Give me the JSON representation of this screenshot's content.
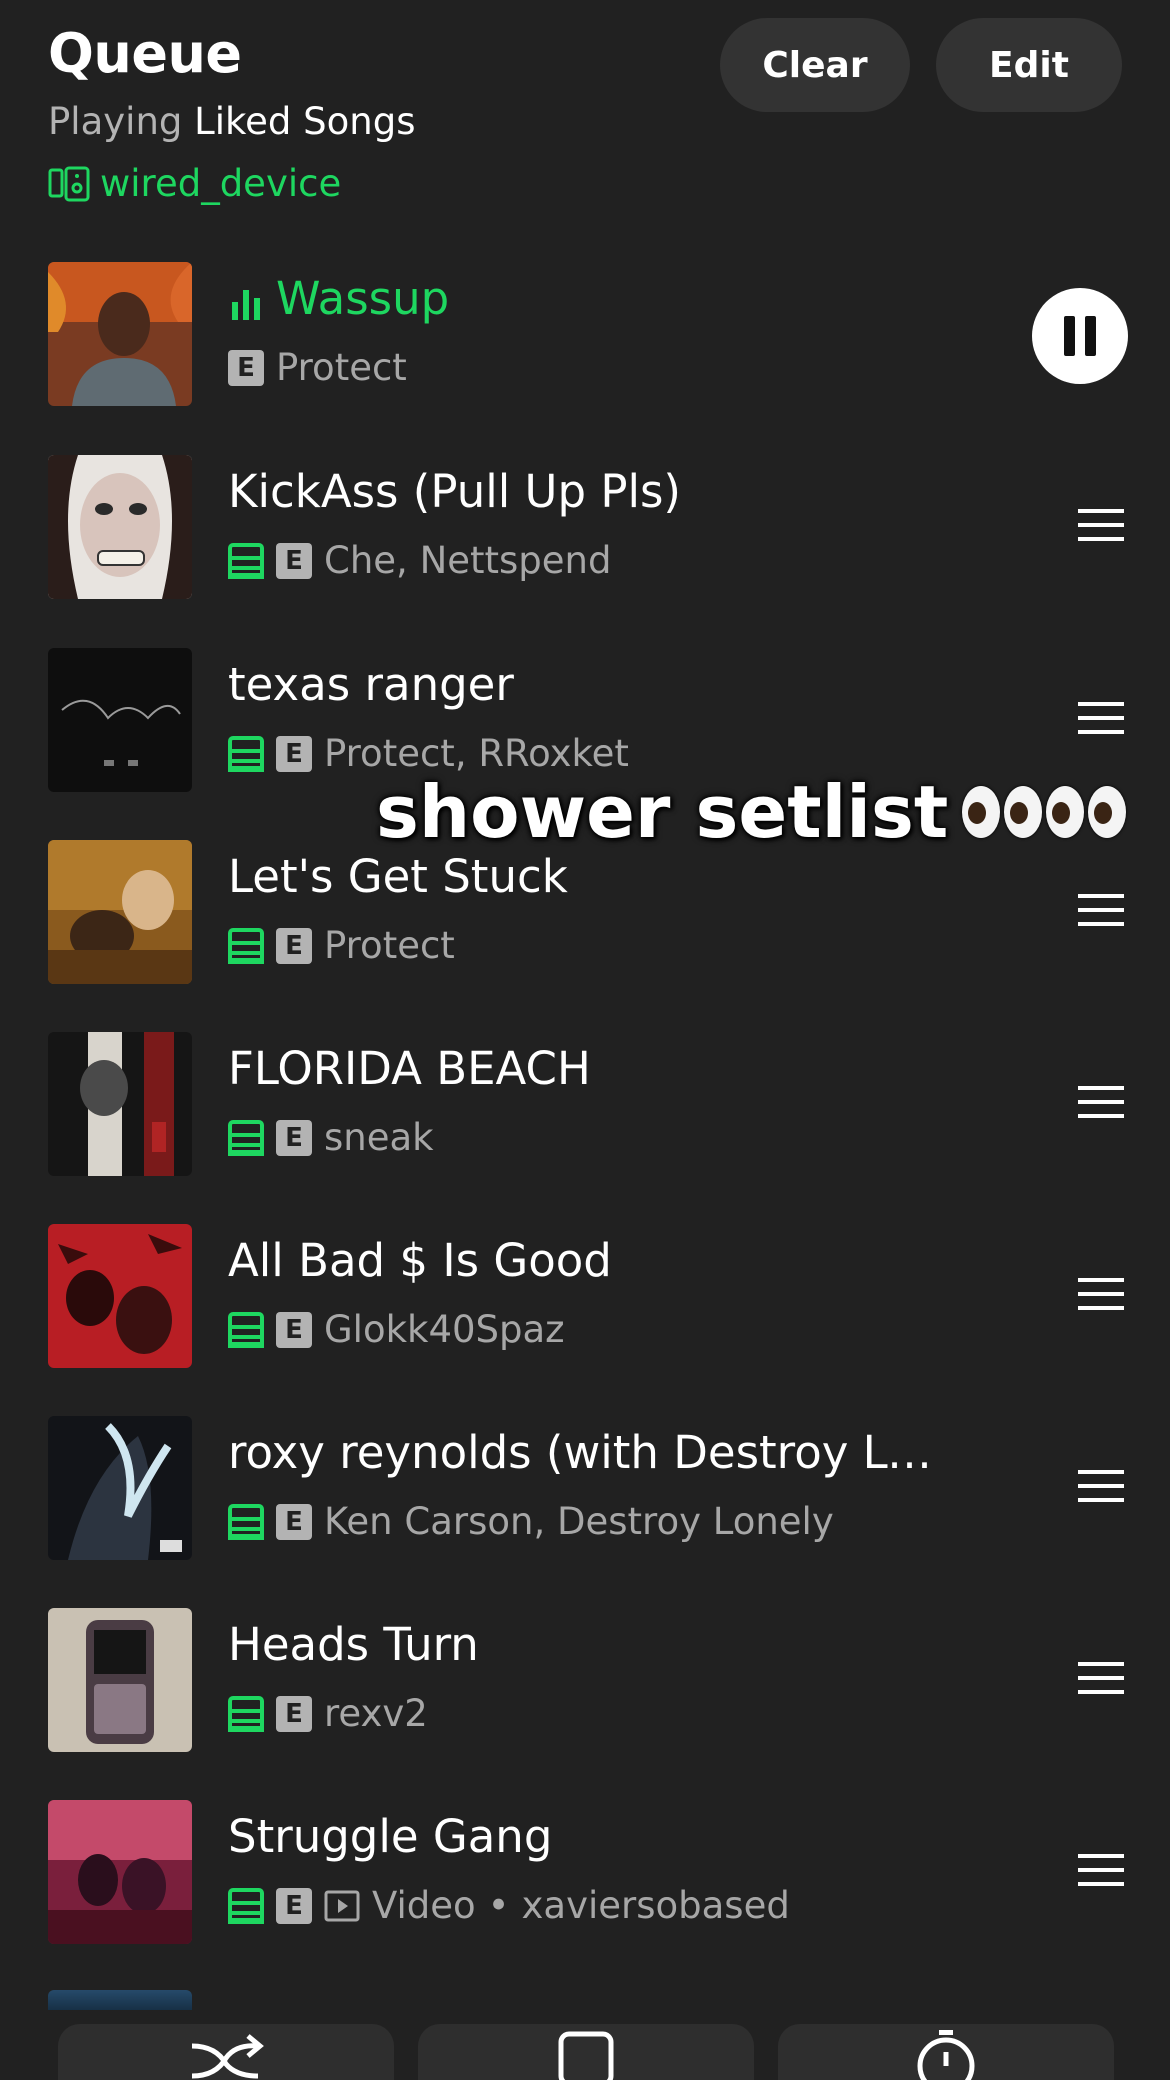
{
  "header": {
    "title": "Queue",
    "context_prefix": "Playing",
    "context_name": "Liked Songs",
    "device": "wired_device",
    "clear_label": "Clear",
    "edit_label": "Edit"
  },
  "now_playing": {
    "title": "Wassup",
    "explicit": "E",
    "artist": "Protect"
  },
  "queue": [
    {
      "title": "KickAss (Pull Up Pls)",
      "explicit": "E",
      "artist": "Che, Nettspend"
    },
    {
      "title": "texas ranger",
      "explicit": "E",
      "artist": "Protect, RRoxket"
    },
    {
      "title": "Let's Get Stuck",
      "explicit": "E",
      "artist": "Protect"
    },
    {
      "title": "FLORIDA BEACH",
      "explicit": "E",
      "artist": "sneak"
    },
    {
      "title": "All Bad $ Is Good",
      "explicit": "E",
      "artist": "Glokk40Spaz"
    },
    {
      "title": "roxy reynolds (with Destroy Lon...",
      "explicit": "E",
      "artist": "Ken Carson, Destroy Lonely"
    },
    {
      "title": "Heads Turn",
      "explicit": "E",
      "artist": "rexv2"
    },
    {
      "title": "Struggle Gang",
      "explicit": "E",
      "type": "Video",
      "separator": "•",
      "artist": "xaviersobased"
    }
  ],
  "overlay": {
    "caption": "shower setlist"
  },
  "colors": {
    "background": "#212121",
    "accent": "#1ed760",
    "button": "#333333",
    "secondary_text": "#a7a7a7"
  },
  "icons": [
    "device-icon",
    "equalizer-icon",
    "pause-icon",
    "downloaded-icon",
    "drag-handle-icon",
    "video-icon",
    "shuffle-icon",
    "device-picker-icon",
    "sleep-timer-icon"
  ]
}
